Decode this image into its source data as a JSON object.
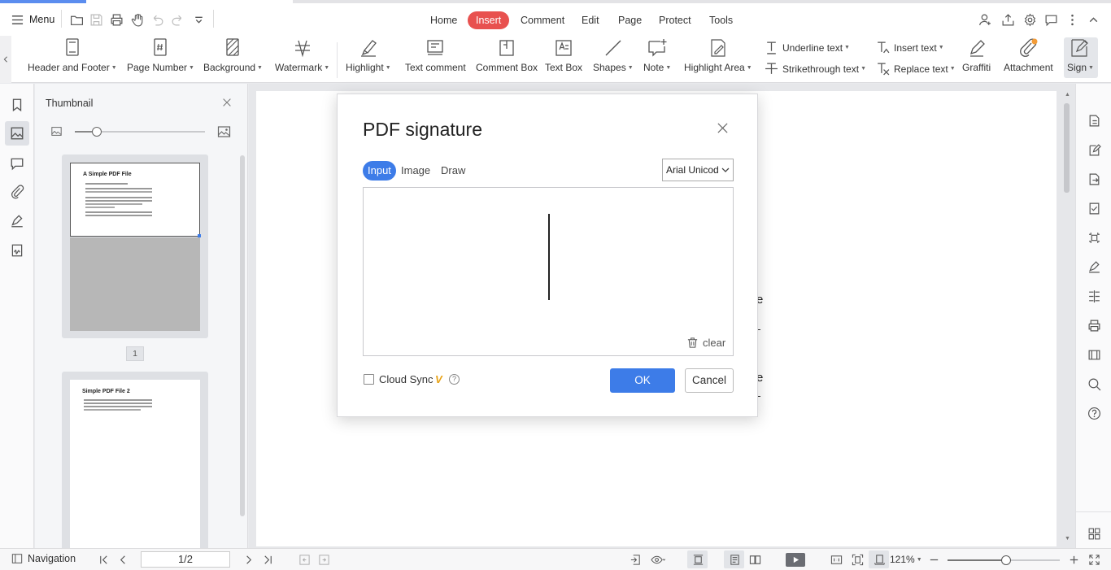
{
  "topbar": {
    "menu_label": "Menu",
    "tabs": [
      {
        "label": "Home",
        "active": false
      },
      {
        "label": "Insert",
        "active": true
      },
      {
        "label": "Comment",
        "active": false
      },
      {
        "label": "Edit",
        "active": false
      },
      {
        "label": "Page",
        "active": false
      },
      {
        "label": "Protect",
        "active": false
      },
      {
        "label": "Tools",
        "active": false
      }
    ],
    "accent_color": "#e8514f"
  },
  "ribbon": {
    "header_footer": "Header and Footer",
    "page_number": "Page Number",
    "background": "Background",
    "watermark": "Watermark",
    "highlight": "Highlight",
    "text_comment": "Text comment",
    "comment_box": "Comment Box",
    "text_box": "Text Box",
    "shapes": "Shapes",
    "note": "Note",
    "highlight_area": "Highlight Area",
    "underline_text": "Underline text",
    "strikethrough_text": "Strikethrough text",
    "insert_text": "Insert text",
    "replace_text": "Replace text",
    "graffiti": "Graffiti",
    "attachment": "Attachment",
    "sign": "Sign"
  },
  "thumbnail_panel": {
    "title": "Thumbnail",
    "zoom_level": 0.17,
    "page1_title": "A Simple PDF File",
    "page1_number": "1",
    "page2_title": "Simple PDF File 2"
  },
  "dialog": {
    "title": "PDF signature",
    "tabs": [
      "Input",
      "Image",
      "Draw"
    ],
    "active_tab": "Input",
    "font_select": "Arial Unicod",
    "clear_label": "clear",
    "cloud_sync_label": "Cloud Sync",
    "vip_badge": "V",
    "ok_label": "OK",
    "cancel_label": "Cancel",
    "ok_color": "#3d7ce8"
  },
  "statusbar": {
    "navigation_label": "Navigation",
    "page_indicator": "1/2",
    "zoom": "121%",
    "zoom_fraction": 0.52
  }
}
